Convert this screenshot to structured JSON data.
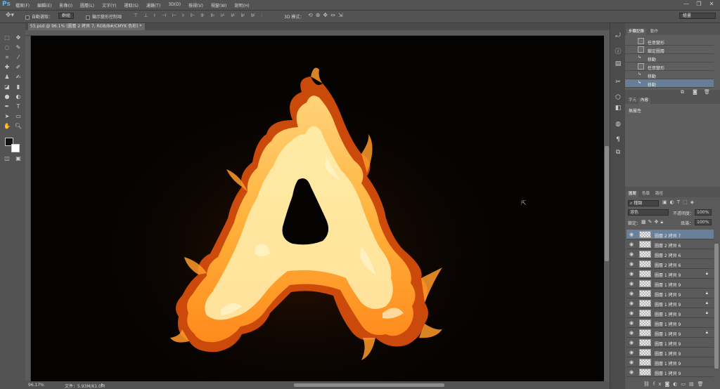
{
  "app": {
    "logo": "Ps"
  },
  "menu": [
    "檔案(F)",
    "編輯(E)",
    "影像(I)",
    "圖層(L)",
    "文字(Y)",
    "選取(S)",
    "濾鏡(T)",
    "3D(D)",
    "檢視(V)",
    "視窗(W)",
    "說明(H)"
  ],
  "window_controls": {
    "minimize": "—",
    "restore": "❐",
    "close": "✕"
  },
  "options_bar": {
    "auto_select_label": "自動選取：",
    "auto_select_value": "群組",
    "show_transform_label": "顯示變形控制項",
    "mode_3d_label": "3D 模式：",
    "workspace": "繪畫"
  },
  "document": {
    "tab_title": "55.psd @ 96.1% (圖層 2 拷貝 7, RGB/8#/CMYK 色彩) *",
    "zoom": "96.17%",
    "file_info": "文件：5.93M/61.0M"
  },
  "history_panel": {
    "tabs": [
      "步驟記錄",
      "動作"
    ],
    "items": [
      {
        "label": "任意變形",
        "icon": "transform-icon"
      },
      {
        "label": "鎖定圖層",
        "icon": "lock-layer-icon"
      },
      {
        "label": "移動",
        "icon": "move-icon"
      },
      {
        "label": "任意變形",
        "icon": "transform-icon"
      },
      {
        "label": "移動",
        "icon": "move-icon"
      },
      {
        "label": "移動",
        "icon": "move-icon"
      }
    ],
    "selected_index": 5
  },
  "properties_panel": {
    "tabs": [
      "字元",
      "內容"
    ],
    "content": "無屬性"
  },
  "layers_panel": {
    "tabs": [
      "圖層",
      "色版",
      "路徑"
    ],
    "filter_kind": "種類",
    "blend_mode": "溶色",
    "opacity_label": "不透明度：",
    "opacity_value": "100%",
    "lock_label": "鎖定：",
    "fill_label": "填滿：",
    "fill_value": "100%",
    "layers": [
      {
        "name": "圖層 2 拷貝 7",
        "locked": false,
        "selected": true
      },
      {
        "name": "圖層 2 拷貝 6",
        "locked": false,
        "selected": false
      },
      {
        "name": "圖層 2 拷貝 6",
        "locked": false,
        "selected": false
      },
      {
        "name": "圖層 2 拷貝 6",
        "locked": false,
        "selected": false
      },
      {
        "name": "圖層 1 拷貝 9",
        "locked": true,
        "selected": false
      },
      {
        "name": "圖層 1 拷貝 9",
        "locked": false,
        "selected": false
      },
      {
        "name": "圖層 1 拷貝 9",
        "locked": true,
        "selected": false
      },
      {
        "name": "圖層 1 拷貝 9",
        "locked": true,
        "selected": false
      },
      {
        "name": "圖層 1 拷貝 9",
        "locked": true,
        "selected": false
      },
      {
        "name": "圖層 1 拷貝 9",
        "locked": false,
        "selected": false
      },
      {
        "name": "圖層 1 拷貝 9",
        "locked": true,
        "selected": false
      },
      {
        "name": "圖層 1 拷貝 9",
        "locked": false,
        "selected": false
      },
      {
        "name": "圖層 1 拷貝 9",
        "locked": false,
        "selected": false
      },
      {
        "name": "圖層 1 拷貝 9",
        "locked": false,
        "selected": false
      },
      {
        "name": "圖層 1 拷貝 9",
        "locked": false,
        "selected": false
      }
    ]
  },
  "colors": {
    "selection": "#687e98",
    "flame_core": "#fff2b0",
    "flame_mid": "#ffb13b",
    "flame_edge": "#e0520c"
  }
}
